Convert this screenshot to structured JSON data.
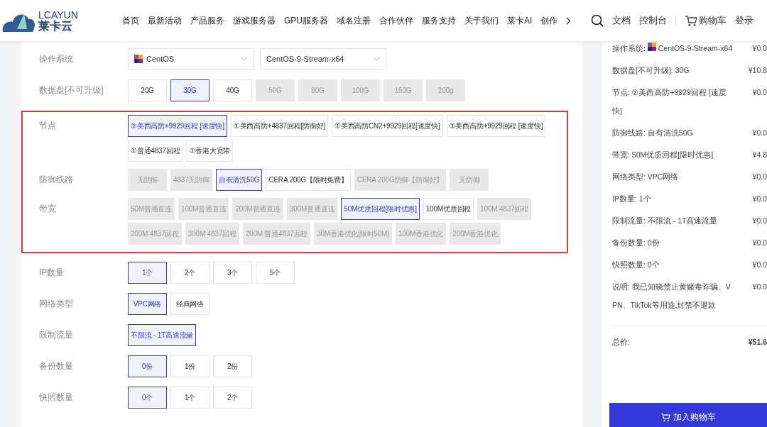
{
  "header": {
    "logo": {
      "latin": "LCAYUN",
      "chinese": "莱卡云"
    },
    "nav": [
      "首页",
      "最新活动",
      "产品服务",
      "游戏服务器",
      "GPU服务器",
      "域名注册",
      "合作伙伴",
      "服务支持",
      "关于我们",
      "莱卡AI",
      "创作"
    ],
    "links": [
      "文档",
      "控制台"
    ],
    "cart": "购物车",
    "login": "登录"
  },
  "config": {
    "os_row": {
      "label": "操作系统",
      "distro": "CentOS",
      "version": "CentOS-9-Stream-x64"
    },
    "rows_before": [
      {
        "label": "数据盘[不可升级]",
        "options": [
          {
            "label": "20G",
            "selected": false,
            "disabled": false
          },
          {
            "label": "30G",
            "selected": true,
            "disabled": false
          },
          {
            "label": "40G",
            "selected": false,
            "disabled": false
          },
          {
            "label": "50G",
            "selected": false,
            "disabled": true
          },
          {
            "label": "80G",
            "selected": false,
            "disabled": true
          },
          {
            "label": "100G",
            "selected": false,
            "disabled": true
          },
          {
            "label": "150G",
            "selected": false,
            "disabled": true
          },
          {
            "label": "200g",
            "selected": false,
            "disabled": true
          }
        ]
      }
    ],
    "highlighted_rows": [
      {
        "label": "节点",
        "options": [
          {
            "label": "②美西高防+9929回程 [速度快]",
            "selected": true,
            "disabled": false
          },
          {
            "label": "①美西高防+4837回程[防御好]",
            "selected": false,
            "disabled": false
          },
          {
            "label": "①美西高防CN2+9929回程[速度快]",
            "selected": false,
            "disabled": false
          },
          {
            "label": "①美西高防+9929回程 [速度快]",
            "selected": false,
            "disabled": false
          },
          {
            "label": "①普通4837回程",
            "selected": false,
            "disabled": false
          },
          {
            "label": "①香港大宽带",
            "selected": false,
            "disabled": false
          }
        ]
      },
      {
        "label": "防御线路",
        "options": [
          {
            "label": "无防御",
            "selected": false,
            "disabled": true
          },
          {
            "label": "4837无防御",
            "selected": false,
            "disabled": true
          },
          {
            "label": "自有清洗50G",
            "selected": true,
            "disabled": false
          },
          {
            "label": "CERA 200G【限时免费】",
            "selected": false,
            "disabled": false
          },
          {
            "label": "CERA 200G防御【防御好】",
            "selected": false,
            "disabled": true
          },
          {
            "label": "无防御",
            "selected": false,
            "disabled": true
          }
        ]
      },
      {
        "label": "带宽",
        "options": [
          {
            "label": "50M普通直连",
            "selected": false,
            "disabled": true
          },
          {
            "label": "100M普通直连",
            "selected": false,
            "disabled": true
          },
          {
            "label": "200M普通直连",
            "selected": false,
            "disabled": true
          },
          {
            "label": "300M普通直连",
            "selected": false,
            "disabled": true
          },
          {
            "label": "50M优质回程[限时优惠]",
            "selected": true,
            "disabled": false
          },
          {
            "label": "100M优质回程",
            "selected": false,
            "disabled": false
          },
          {
            "label": "100M 4837回程",
            "selected": false,
            "disabled": true
          },
          {
            "label": "200M 4837回程",
            "selected": false,
            "disabled": true
          },
          {
            "label": "300M 4837回程",
            "selected": false,
            "disabled": true
          },
          {
            "label": "200M 普通4837回程",
            "selected": false,
            "disabled": true
          },
          {
            "label": "30M香港优化[限时50M]",
            "selected": false,
            "disabled": true
          },
          {
            "label": "100M香港优化",
            "selected": false,
            "disabled": true
          },
          {
            "label": "200M香港优化",
            "selected": false,
            "disabled": true
          }
        ]
      }
    ],
    "rows_after": [
      {
        "label": "IP数量",
        "options": [
          {
            "label": "1个",
            "selected": true,
            "disabled": false
          },
          {
            "label": "2个",
            "selected": false,
            "disabled": false
          },
          {
            "label": "3个",
            "selected": false,
            "disabled": false
          },
          {
            "label": "5个",
            "selected": false,
            "disabled": false
          }
        ]
      },
      {
        "label": "网络类型",
        "options": [
          {
            "label": "VPC网络",
            "selected": true,
            "disabled": false
          },
          {
            "label": "经典网络",
            "selected": false,
            "disabled": false
          }
        ]
      },
      {
        "label": "限制流量",
        "options": [
          {
            "label": "不限流 - 1T高速流量",
            "selected": true,
            "disabled": false
          }
        ]
      },
      {
        "label": "备份数量",
        "options": [
          {
            "label": "0份",
            "selected": true,
            "disabled": false
          },
          {
            "label": "1份",
            "selected": false,
            "disabled": false
          },
          {
            "label": "2份",
            "selected": false,
            "disabled": false
          }
        ]
      },
      {
        "label": "快照数量",
        "options": [
          {
            "label": "0个",
            "selected": true,
            "disabled": false
          },
          {
            "label": "1个",
            "selected": false,
            "disabled": false
          },
          {
            "label": "2个",
            "selected": false,
            "disabled": false
          }
        ]
      }
    ]
  },
  "summary": {
    "items": [
      {
        "kind": "os",
        "label": "操作系统:",
        "value": "CentOS-9-Stream-x64",
        "price": "¥0.0"
      },
      {
        "kind": "plain",
        "label": "数据盘[不可升级]:",
        "value": "30G",
        "price": "¥10.8"
      },
      {
        "kind": "plain",
        "label": "节点:",
        "value": "②美西高防+9929回程 [速度快]",
        "price": "¥0.0"
      },
      {
        "kind": "plain",
        "label": "防御线路:",
        "value": "自有清洗50G",
        "price": "¥0.0"
      },
      {
        "kind": "plain",
        "label": "带宽:",
        "value": "50M优质回程[限时优惠]",
        "price": "¥4.8"
      },
      {
        "kind": "plain",
        "label": "网络类型:",
        "value": "VPC网络",
        "price": "¥0.0"
      },
      {
        "kind": "plain",
        "label": "IP数量:",
        "value": "1个",
        "price": "¥0.0"
      },
      {
        "kind": "plain",
        "label": "限制流量:",
        "value": "不限流 - 1T高速流量",
        "price": "¥0.0"
      },
      {
        "kind": "plain",
        "label": "备份数量:",
        "value": "0份",
        "price": "¥0.0"
      },
      {
        "kind": "plain",
        "label": "快照数量:",
        "value": "0个",
        "price": "¥0.0"
      },
      {
        "kind": "plain",
        "label": "说明:",
        "value": "我已知晓禁止黄赌毒诈骗、VPN、TikTok等用途,封禁不退款",
        "price": "¥0.0"
      }
    ],
    "total_label": "总价:",
    "total": "¥51.6",
    "add_to_cart": "加入购物车"
  }
}
